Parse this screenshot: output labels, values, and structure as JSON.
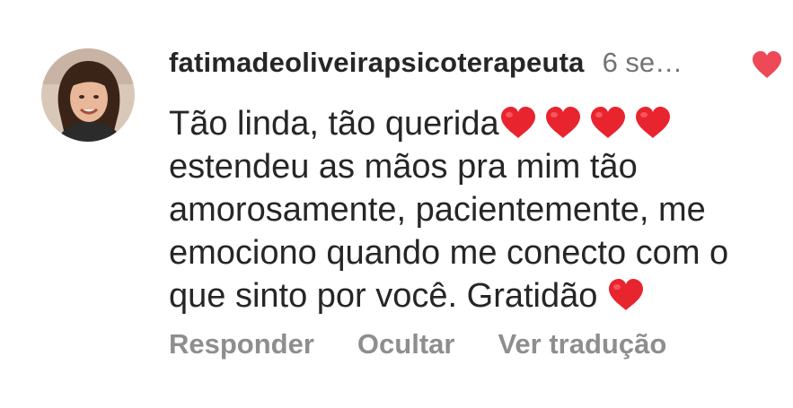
{
  "comment": {
    "username": "fatimadeoliveirapsicoterapeuta",
    "time": "6 se…",
    "text_lines": [
      "Tão linda, tão querida",
      "estendeu as mãos pra mim tão",
      "amorosamente, pacientemente, me",
      "emociono quando me conecto com o",
      "que sinto por você. Gratidão "
    ],
    "liked": true,
    "like_icon": "heart-icon",
    "like_color": "#ed4956",
    "emoji_color": "#e8242f"
  },
  "actions": {
    "reply": "Responder",
    "hide": "Ocultar",
    "translate": "Ver tradução"
  }
}
